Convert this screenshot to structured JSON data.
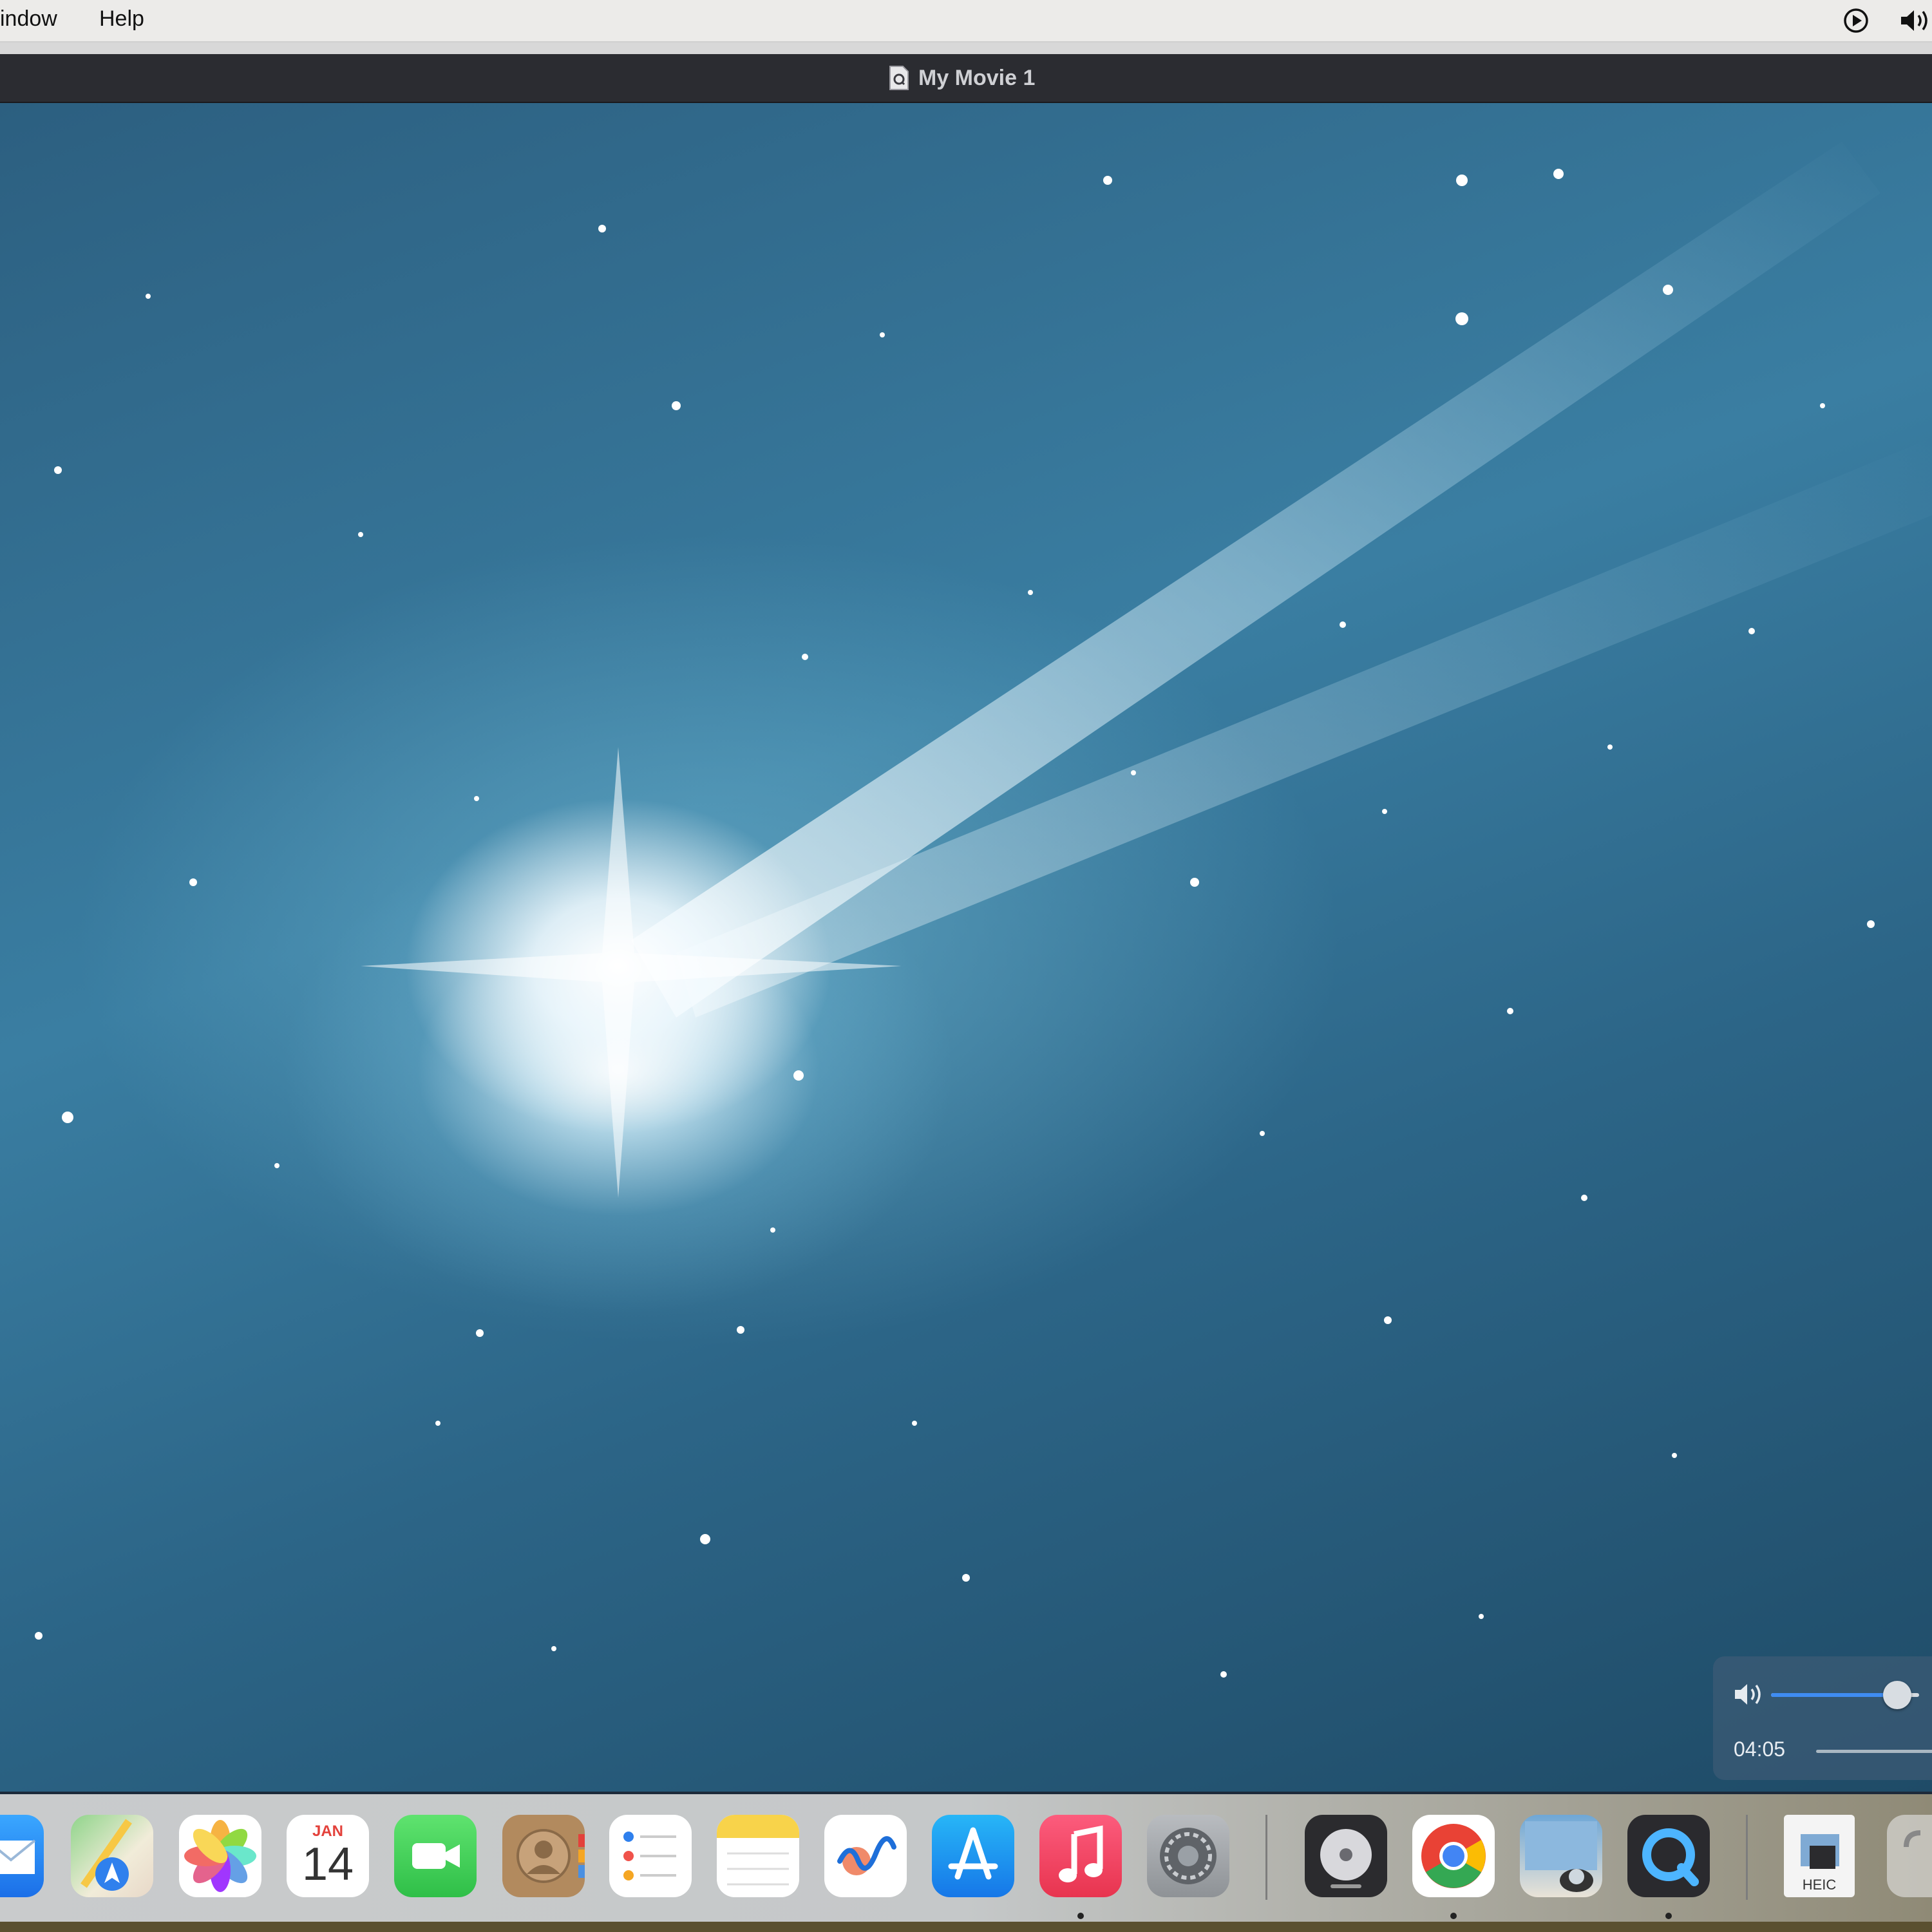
{
  "menubar": {
    "items": [
      "indow",
      "Help"
    ]
  },
  "window": {
    "title": "My Movie 1"
  },
  "player": {
    "time": "04:05",
    "volume_level": 0.85
  },
  "dock": {
    "calendar_month": "JAN",
    "calendar_day": "14",
    "file_label": "HEIC",
    "apps": [
      "mail-icon",
      "maps-icon",
      "photos-icon",
      "calendar-icon",
      "facetime-icon",
      "contacts-icon",
      "reminders-icon",
      "notes-icon",
      "freeform-icon",
      "app-store-icon",
      "music-icon",
      "system-settings-icon",
      "logic-icon",
      "chrome-icon",
      "preview-icon",
      "quicktime-icon",
      "heic-file-icon",
      "help-icon"
    ]
  },
  "colors": {
    "accent": "#3f8cf2",
    "titlebar": "#2b2c31",
    "menubar": "#ecebe9"
  }
}
